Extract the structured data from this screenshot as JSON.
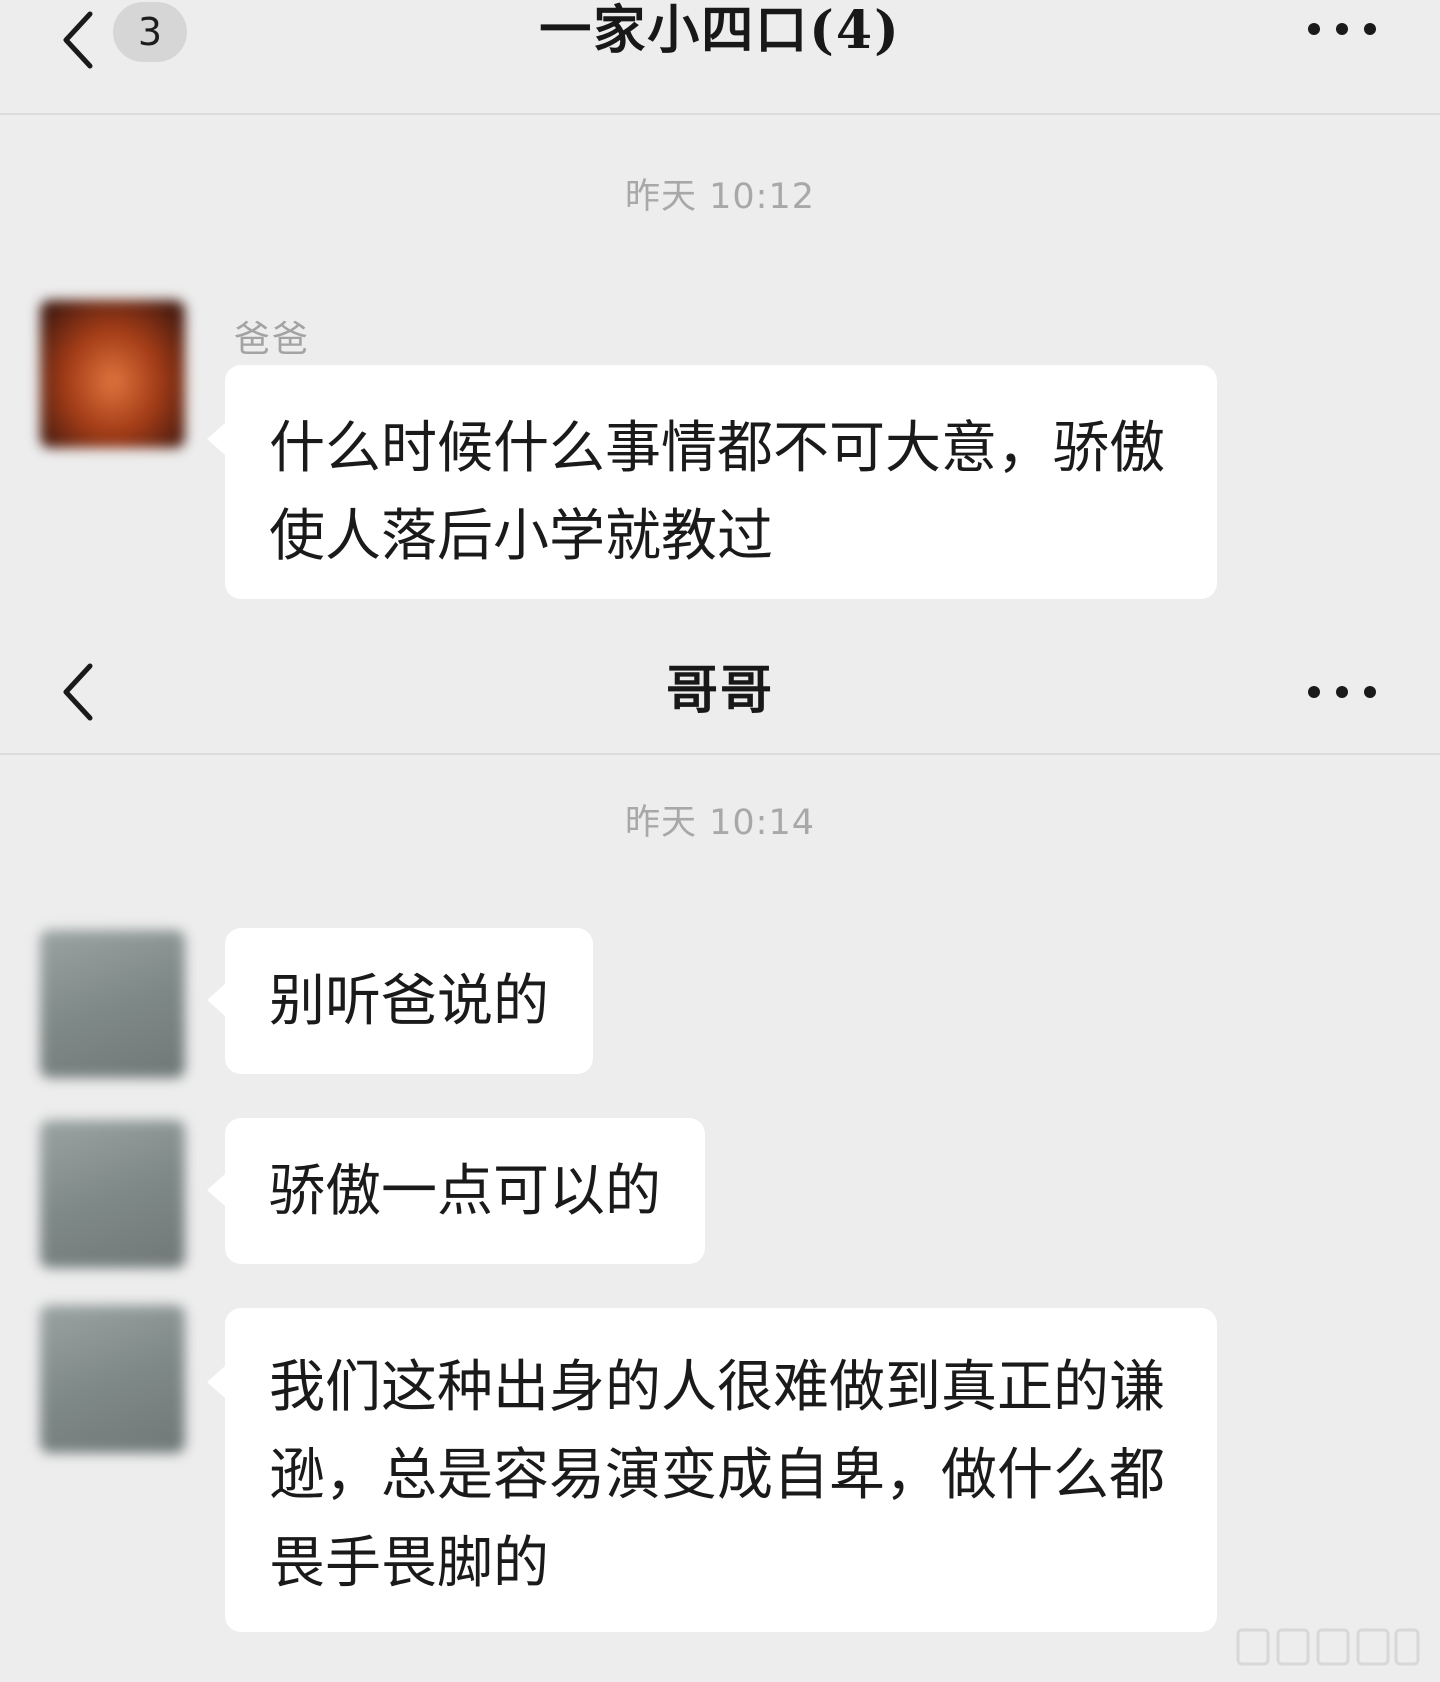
{
  "group_chat": {
    "unread_count": "3",
    "title": "一家小四口(4)",
    "timestamp": "昨天 10:12",
    "sender_name": "爸爸",
    "message": "什么时候什么事情都不可大意，骄傲使人落后小学就教过"
  },
  "direct_chat": {
    "title": "哥哥",
    "timestamp": "昨天 10:14",
    "messages": [
      {
        "text": "别听爸说的"
      },
      {
        "text": "骄傲一点可以的"
      },
      {
        "text": "我们这种出身的人很难做到真正的谦逊，总是容易演变成自卑，做什么都畏手畏脚的"
      }
    ]
  },
  "icons": {
    "back": "chevron-left-icon",
    "more": "ellipsis-icon"
  },
  "colors": {
    "background": "#ededed",
    "bubble": "#ffffff",
    "timestamp_text": "#a8a8a8",
    "badge": "#d6d6d6"
  }
}
